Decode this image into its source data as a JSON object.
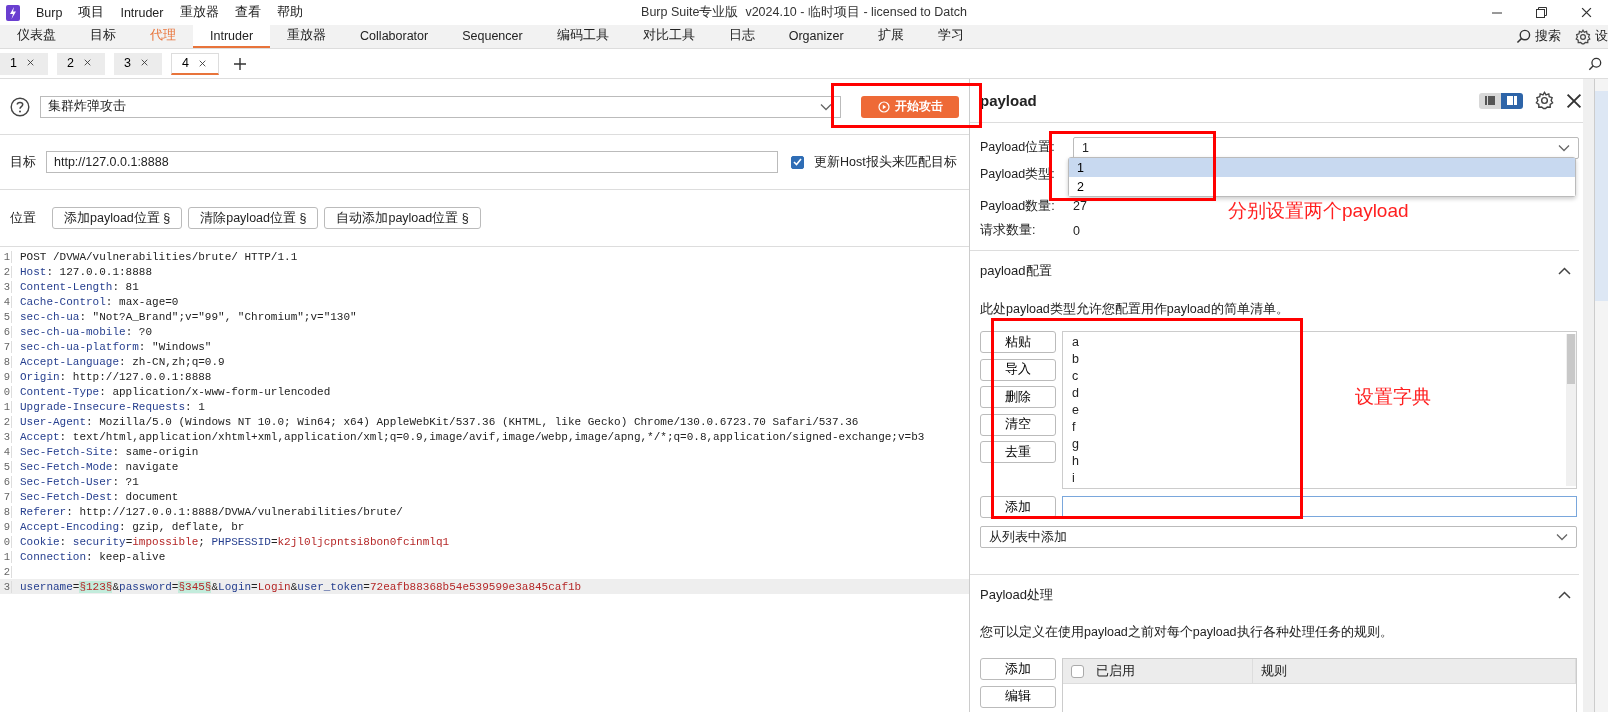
{
  "title_bar": {
    "menu": [
      "Burp",
      "项目",
      "Intruder",
      "重放器",
      "查看",
      "帮助"
    ],
    "title": "Burp Suite专业版  v2024.10 - 临时项目 - licensed to Datch"
  },
  "main_tabs": [
    {
      "label": "仪表盘",
      "selected": false,
      "highlighted": false
    },
    {
      "label": "目标",
      "selected": false,
      "highlighted": false
    },
    {
      "label": "代理",
      "selected": false,
      "highlighted": true
    },
    {
      "label": "Intruder",
      "selected": true,
      "highlighted": false
    },
    {
      "label": "重放器",
      "selected": false,
      "highlighted": false
    },
    {
      "label": "Collaborator",
      "selected": false,
      "highlighted": false
    },
    {
      "label": "Sequencer",
      "selected": false,
      "highlighted": false
    },
    {
      "label": "编码工具",
      "selected": false,
      "highlighted": false
    },
    {
      "label": "对比工具",
      "selected": false,
      "highlighted": false
    },
    {
      "label": "日志",
      "selected": false,
      "highlighted": false
    },
    {
      "label": "Organizer",
      "selected": false,
      "highlighted": false
    },
    {
      "label": "扩展",
      "selected": false,
      "highlighted": false
    },
    {
      "label": "学习",
      "selected": false,
      "highlighted": false
    }
  ],
  "toolbar_right": {
    "search": "搜索",
    "settings": "设"
  },
  "request_tabs": [
    {
      "label": "1",
      "selected": false
    },
    {
      "label": "2",
      "selected": false
    },
    {
      "label": "3",
      "selected": false
    },
    {
      "label": "4",
      "selected": true
    }
  ],
  "attack": {
    "type": "集群炸弹攻击",
    "start_button": "开始攻击"
  },
  "target": {
    "label": "目标",
    "value": "http://127.0.0.1:8888",
    "update_host": {
      "label": "更新Host报头来匹配目标",
      "checked": true
    }
  },
  "positions": {
    "label": "位置",
    "buttons": [
      "添加payload位置 §",
      "清除payload位置 §",
      "自动添加payload位置 §"
    ]
  },
  "editor_lines": [
    {
      "no": "1",
      "current": false,
      "parts": [
        {
          "kind": "text",
          "text": "POST /DVWA/vulnerabilities/brute/ HTTP/1.1"
        }
      ]
    },
    {
      "no": "2",
      "current": false,
      "parts": [
        {
          "kind": "name",
          "text": "Host"
        },
        {
          "kind": "text",
          "text": ": 127.0.0.1:8888"
        }
      ]
    },
    {
      "no": "3",
      "current": false,
      "parts": [
        {
          "kind": "name",
          "text": "Content-Length"
        },
        {
          "kind": "text",
          "text": ": 81"
        }
      ]
    },
    {
      "no": "4",
      "current": false,
      "parts": [
        {
          "kind": "name",
          "text": "Cache-Control"
        },
        {
          "kind": "text",
          "text": ": max-age=0"
        }
      ]
    },
    {
      "no": "5",
      "current": false,
      "parts": [
        {
          "kind": "name",
          "text": "sec-ch-ua"
        },
        {
          "kind": "text",
          "text": ": \"Not?A_Brand\";v=\"99\", \"Chromium\";v=\"130\""
        }
      ]
    },
    {
      "no": "6",
      "current": false,
      "parts": [
        {
          "kind": "name",
          "text": "sec-ch-ua-mobile"
        },
        {
          "kind": "text",
          "text": ": ?0"
        }
      ]
    },
    {
      "no": "7",
      "current": false,
      "parts": [
        {
          "kind": "name",
          "text": "sec-ch-ua-platform"
        },
        {
          "kind": "text",
          "text": ": \"Windows\""
        }
      ]
    },
    {
      "no": "8",
      "current": false,
      "parts": [
        {
          "kind": "name",
          "text": "Accept-Language"
        },
        {
          "kind": "text",
          "text": ": zh-CN,zh;q=0.9"
        }
      ]
    },
    {
      "no": "9",
      "current": false,
      "parts": [
        {
          "kind": "name",
          "text": "Origin"
        },
        {
          "kind": "text",
          "text": ": http://127.0.0.1:8888"
        }
      ]
    },
    {
      "no": "0",
      "current": false,
      "parts": [
        {
          "kind": "name",
          "text": "Content-Type"
        },
        {
          "kind": "text",
          "text": ": application/x-www-form-urlencoded"
        }
      ]
    },
    {
      "no": "1",
      "current": false,
      "parts": [
        {
          "kind": "name",
          "text": "Upgrade-Insecure-Requests"
        },
        {
          "kind": "text",
          "text": ": 1"
        }
      ]
    },
    {
      "no": "2",
      "current": false,
      "parts": [
        {
          "kind": "name",
          "text": "User-Agent"
        },
        {
          "kind": "text",
          "text": ": Mozilla/5.0 (Windows NT 10.0; Win64; x64) AppleWebKit/537.36 (KHTML, like Gecko) Chrome/130.0.6723.70 Safari/537.36"
        }
      ]
    },
    {
      "no": "3",
      "current": false,
      "parts": [
        {
          "kind": "name",
          "text": "Accept"
        },
        {
          "kind": "text",
          "text": ": text/html,application/xhtml+xml,application/xml;q=0.9,image/avif,image/webp,image/apng,*/*;q=0.8,application/signed-exchange;v=b3"
        }
      ]
    },
    {
      "no": "4",
      "current": false,
      "parts": [
        {
          "kind": "name",
          "text": "Sec-Fetch-Site"
        },
        {
          "kind": "text",
          "text": ": same-origin"
        }
      ]
    },
    {
      "no": "5",
      "current": false,
      "parts": [
        {
          "kind": "name",
          "text": "Sec-Fetch-Mode"
        },
        {
          "kind": "text",
          "text": ": navigate"
        }
      ]
    },
    {
      "no": "6",
      "current": false,
      "parts": [
        {
          "kind": "name",
          "text": "Sec-Fetch-User"
        },
        {
          "kind": "text",
          "text": ": ?1"
        }
      ]
    },
    {
      "no": "7",
      "current": false,
      "parts": [
        {
          "kind": "name",
          "text": "Sec-Fetch-Dest"
        },
        {
          "kind": "text",
          "text": ": document"
        }
      ]
    },
    {
      "no": "8",
      "current": false,
      "parts": [
        {
          "kind": "name",
          "text": "Referer"
        },
        {
          "kind": "text",
          "text": ": http://127.0.0.1:8888/DVWA/vulnerabilities/brute/"
        }
      ]
    },
    {
      "no": "9",
      "current": false,
      "parts": [
        {
          "kind": "name",
          "text": "Accept-Encoding"
        },
        {
          "kind": "text",
          "text": ": gzip, deflate, br"
        }
      ]
    },
    {
      "no": "0",
      "current": false,
      "parts": [
        {
          "kind": "name",
          "text": "Cookie"
        },
        {
          "kind": "text",
          "text": ": "
        },
        {
          "kind": "name",
          "text": "security"
        },
        {
          "kind": "text",
          "text": "="
        },
        {
          "kind": "value",
          "text": "impossible"
        },
        {
          "kind": "text",
          "text": "; "
        },
        {
          "kind": "name",
          "text": "PHPSESSID"
        },
        {
          "kind": "text",
          "text": "="
        },
        {
          "kind": "value",
          "text": "k2jl0ljcpntsi8bon0fcinmlq1"
        }
      ]
    },
    {
      "no": "1",
      "current": false,
      "parts": [
        {
          "kind": "name",
          "text": "Connection"
        },
        {
          "kind": "text",
          "text": ": keep-alive"
        }
      ]
    },
    {
      "no": "2",
      "current": false
    },
    {
      "no": "3",
      "current": true,
      "parts": [
        {
          "kind": "name",
          "text": "username"
        },
        {
          "kind": "text",
          "text": "="
        },
        {
          "kind": "marker",
          "text": "§123§"
        },
        {
          "kind": "text",
          "text": "&"
        },
        {
          "kind": "name",
          "text": "password"
        },
        {
          "kind": "text",
          "text": "="
        },
        {
          "kind": "marker",
          "text": "§345§"
        },
        {
          "kind": "text",
          "text": "&"
        },
        {
          "kind": "name",
          "text": "Login"
        },
        {
          "kind": "text",
          "text": "="
        },
        {
          "kind": "value",
          "text": "Login"
        },
        {
          "kind": "text",
          "text": "&"
        },
        {
          "kind": "name",
          "text": "user_token"
        },
        {
          "kind": "text",
          "text": "="
        },
        {
          "kind": "value",
          "text": "72eafb88368b54e539599e3a845caf1b"
        }
      ]
    }
  ],
  "payload_panel": {
    "title": "payload",
    "view_modes": [
      {
        "selected": false
      },
      {
        "selected": true
      }
    ],
    "settings": [
      {
        "label": "Payload位置:",
        "value": "1",
        "kind": "dropdown"
      },
      {
        "label": "Payload类型:",
        "kind": "hidden"
      },
      {
        "label": "Payload数量:",
        "value": "27",
        "kind": "text"
      },
      {
        "label": "请求数量:",
        "value": "0",
        "kind": "text"
      }
    ],
    "position_options": [
      {
        "label": "1",
        "selected": true
      },
      {
        "label": "2",
        "selected": false
      }
    ],
    "config": {
      "title": "payload配置",
      "expanded": true,
      "description": "此处payload类型允许您配置用作payload的简单清单。",
      "buttons": [
        "粘贴",
        "导入",
        "删除",
        "清空",
        "去重"
      ],
      "items": [
        "a",
        "b",
        "c",
        "d",
        "e",
        "f",
        "g",
        "h",
        "i"
      ],
      "add_button": "添加",
      "add_from_list": "从列表中添加"
    },
    "processing": {
      "title": "Payload处理",
      "expanded": true,
      "description": "您可以定义在使用payload之前对每个payload执行各种处理任务的规则。",
      "buttons": [
        "添加",
        "编辑"
      ],
      "columns": [
        {
          "label": "已启用",
          "kind": "check",
          "checked": false
        },
        {
          "label": "规则",
          "kind": "text"
        }
      ]
    }
  },
  "annotations": [
    {
      "kind": "box"
    },
    {
      "kind": "box"
    },
    {
      "kind": "box"
    },
    {
      "kind": "label",
      "text": "分别设置两个payload"
    },
    {
      "kind": "label",
      "text": "设置字典"
    }
  ]
}
